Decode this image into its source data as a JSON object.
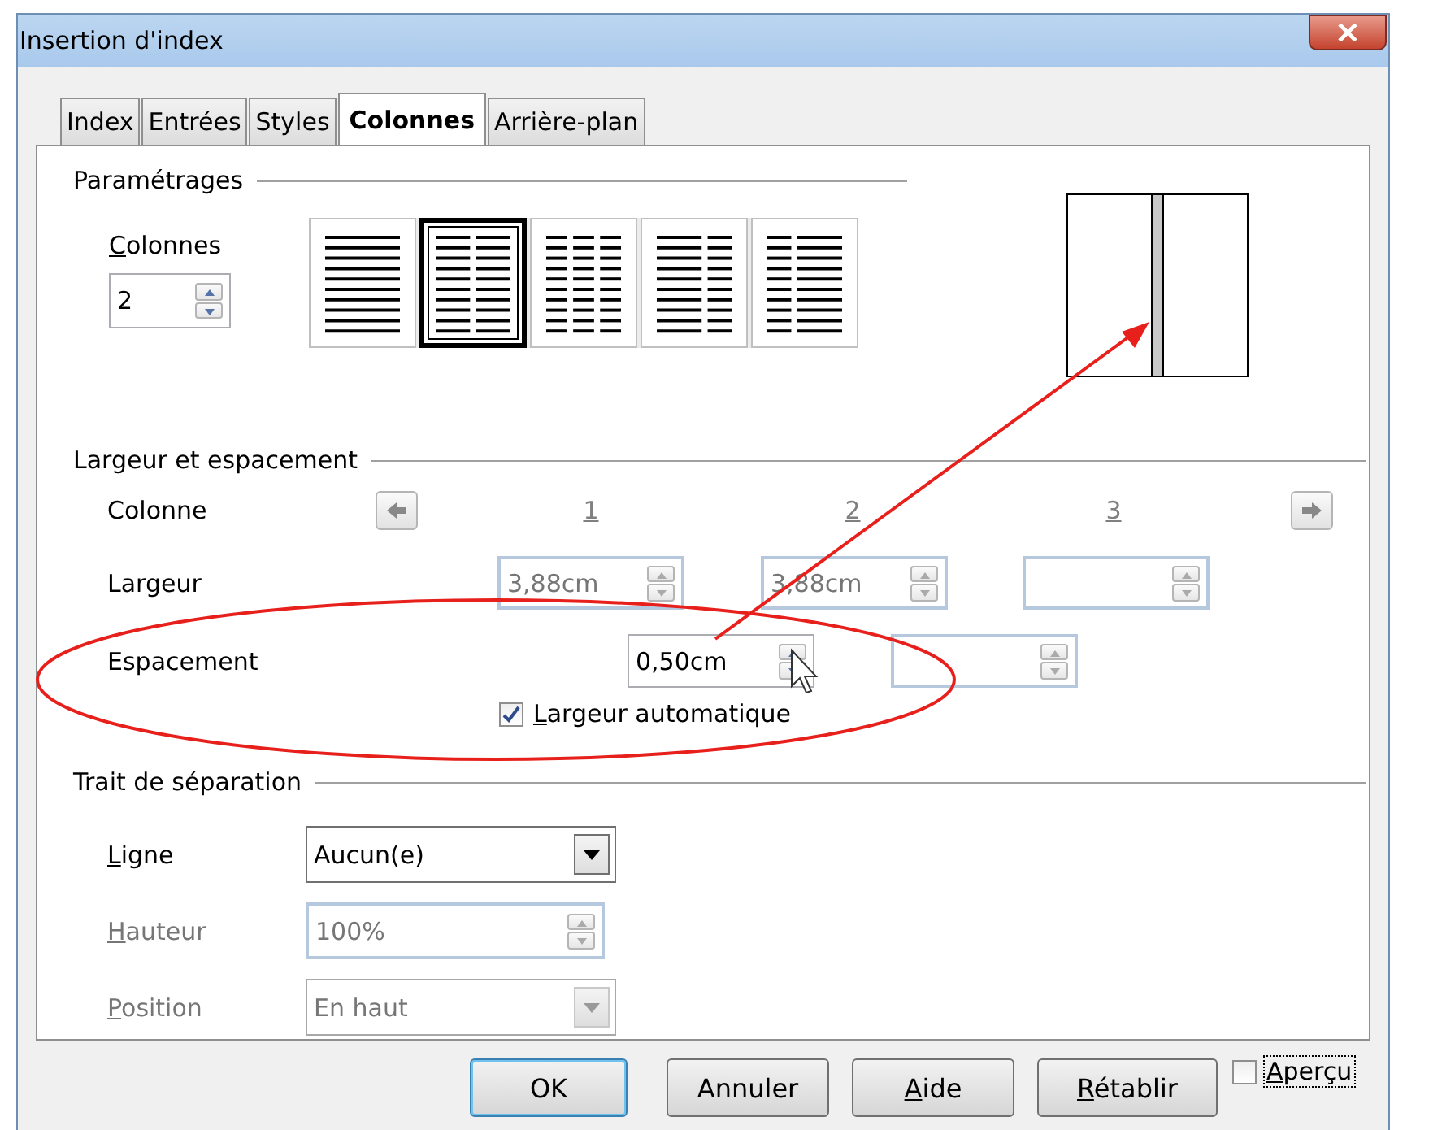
{
  "window": {
    "title": "Insertion d'index"
  },
  "tabs": [
    {
      "label": "Index",
      "selected": false
    },
    {
      "label": "Entrées",
      "selected": false
    },
    {
      "label": "Styles",
      "selected": false
    },
    {
      "label": "Colonnes",
      "selected": true
    },
    {
      "label": "Arrière-plan",
      "selected": false
    }
  ],
  "settings": {
    "title": "Paramétrages",
    "columns_label": "Colonnes",
    "columns_value": "2",
    "presets": [
      {
        "kind": "one",
        "selected": false
      },
      {
        "kind": "two",
        "selected": true
      },
      {
        "kind": "three",
        "selected": false
      },
      {
        "kind": "wide-left",
        "selected": false
      },
      {
        "kind": "wide-right",
        "selected": false
      }
    ]
  },
  "width_spacing": {
    "title": "Largeur et espacement",
    "column_label": "Colonne",
    "column_numbers": [
      "1",
      "2",
      "3"
    ],
    "width_label": "Largeur",
    "widths": [
      {
        "value": "3,88cm",
        "disabled": true
      },
      {
        "value": "3,88cm",
        "disabled": true
      },
      {
        "disabled": true
      }
    ],
    "spacing_label": "Espacement",
    "spacings": [
      {
        "value": "0,50cm",
        "disabled": false
      },
      {
        "disabled": true
      }
    ],
    "auto_width": {
      "label": "Largeur automatique",
      "checked": true
    }
  },
  "separator": {
    "title": "Trait de séparation",
    "rows": [
      {
        "kind": "dropdown",
        "label": "Ligne",
        "value": "Aucun(e)",
        "disabled": false
      },
      {
        "kind": "spin",
        "label": "Hauteur",
        "value": "100%",
        "disabled": true
      },
      {
        "kind": "dropdown",
        "label": "Position",
        "value": "En haut",
        "disabled": true
      }
    ]
  },
  "buttons": [
    {
      "label": "OK",
      "default": true
    },
    {
      "label": "Annuler",
      "default": false
    },
    {
      "label": "Aide",
      "default": false
    },
    {
      "label": "Rétablir",
      "default": false
    }
  ],
  "preview": {
    "label": "Aperçu",
    "checked": false
  }
}
